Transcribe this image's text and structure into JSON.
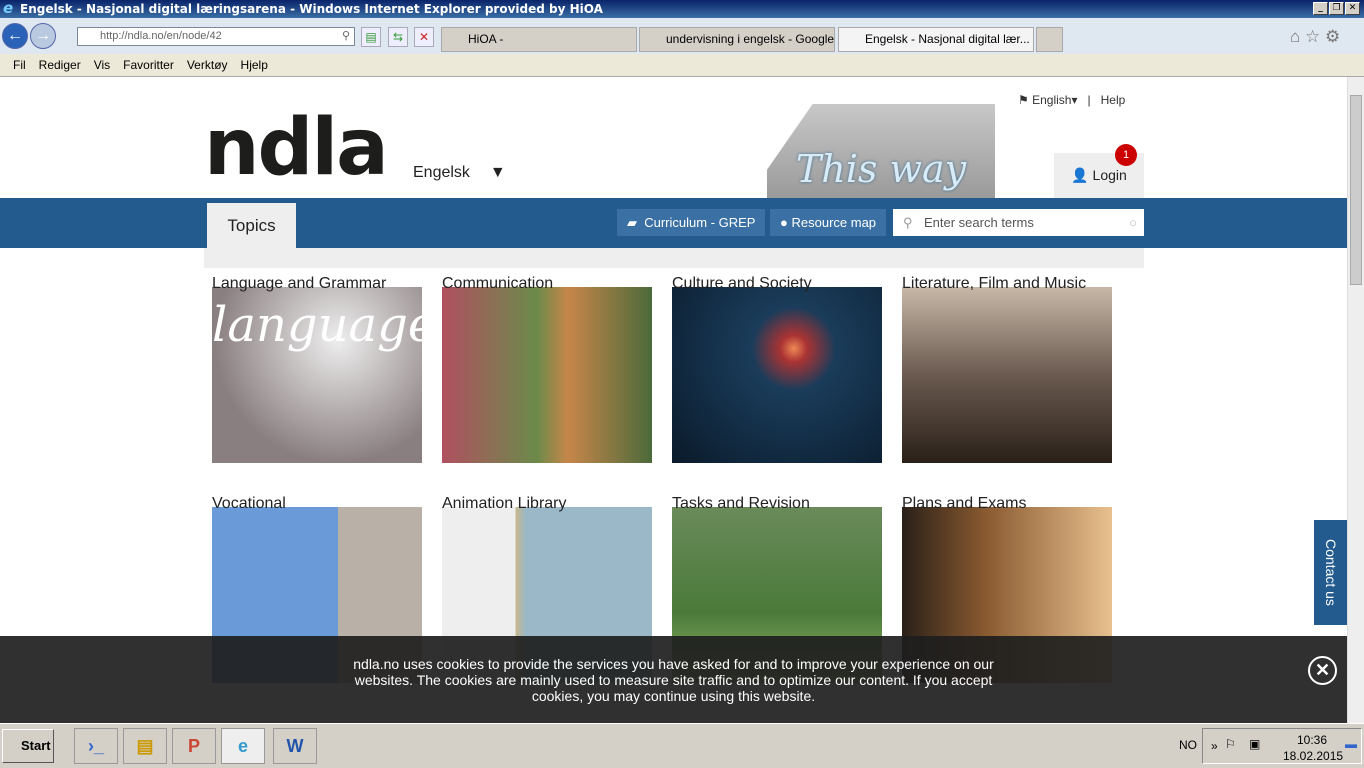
{
  "window": {
    "title": "Engelsk - Nasjonal digital læringsarena - Windows Internet Explorer provided by HiOA"
  },
  "browser": {
    "address": "http://ndla.no/en/node/42",
    "tabs": [
      {
        "label": "HiOA -"
      },
      {
        "label": "undervisning i engelsk - Google-..."
      },
      {
        "label": "Engelsk - Nasjonal digital lær..."
      }
    ],
    "menu": [
      "Fil",
      "Rediger",
      "Vis",
      "Favoritter",
      "Verktøy",
      "Hjelp"
    ]
  },
  "site": {
    "logo": "ndla",
    "subject": "Engelsk",
    "sign_text": "This way",
    "language": "English",
    "help": "Help",
    "login": "Login",
    "notification_count": "1",
    "topics_tab": "Topics",
    "curriculum": "Curriculum - GREP",
    "resource_map": "Resource map",
    "search_placeholder": "Enter search terms",
    "accent": "#245b8f"
  },
  "topics": [
    {
      "title": "Language and Grammar"
    },
    {
      "title": "Communication"
    },
    {
      "title": "Culture and Society"
    },
    {
      "title": "Literature, Film and Music"
    },
    {
      "title": "Vocational"
    },
    {
      "title": "Animation Library"
    },
    {
      "title": "Tasks and Revision"
    },
    {
      "title": "Plans and Exams"
    }
  ],
  "cookie": {
    "text": "ndla.no uses cookies to provide the services you have asked for and to improve your experience on our websites. The cookies are mainly used to measure site traffic and to optimize our content. If you accept cookies, you may continue using this website."
  },
  "contact": "Contact us",
  "taskbar": {
    "start": "Start",
    "lang": "NO",
    "time": "10:36",
    "date": "18.02.2015"
  }
}
